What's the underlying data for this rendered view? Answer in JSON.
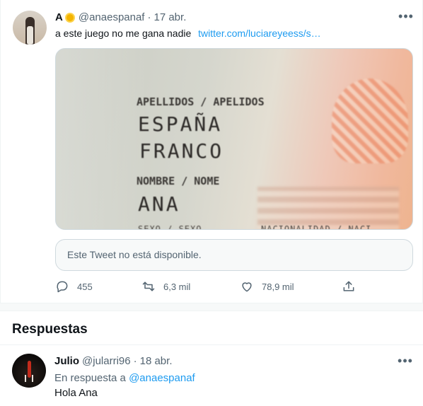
{
  "tweet": {
    "author_name": "A",
    "author_emoji": "sun-emoji",
    "handle": "@anaespanaf",
    "separator": "·",
    "date": "17 abr.",
    "text": "a este juego no me gana nadie",
    "link": "twitter.com/luciareyeess/s…",
    "more_icon": "more-horizontal-icon",
    "media": {
      "lines": [
        "APELLIDOS / APELIDOS",
        "ESPAÑA",
        "FRANCO",
        "NOMBRE / NOME",
        "ANA"
      ],
      "cut_left": "SEXO / SEXO",
      "cut_right": "NACIONALIDAD / NACI"
    },
    "quoted_unavailable": "Este Tweet no está disponible.",
    "actions": [
      {
        "icon": "reply-icon",
        "count": "455"
      },
      {
        "icon": "retweet-icon",
        "count": "6,3 mil"
      },
      {
        "icon": "like-icon",
        "count": "78,9 mil"
      },
      {
        "icon": "share-icon",
        "count": ""
      }
    ]
  },
  "replies_section": {
    "title": "Respuestas"
  },
  "reply": {
    "author_name": "Julio",
    "handle": "@jularri96",
    "separator": "·",
    "date": "18 abr.",
    "in_reply_prefix": "En respuesta a",
    "in_reply_mention": "@anaespanaf",
    "text": "Hola Ana",
    "more_icon": "more-horizontal-icon"
  },
  "colors": {
    "link": "#1d9bf0",
    "secondary_text": "#536471",
    "primary_text": "#0f1419",
    "border": "#eff3f4"
  }
}
